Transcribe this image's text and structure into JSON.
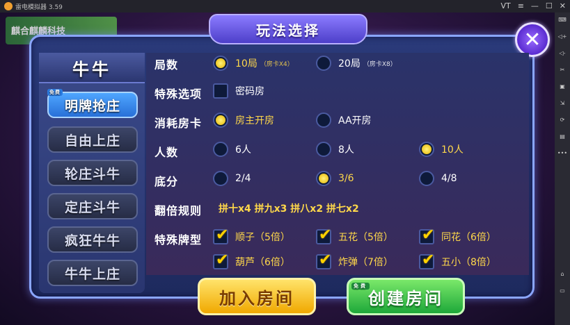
{
  "emulator": {
    "title": "雷电模拟器 3.59",
    "controls": [
      "VT",
      "≡",
      "—",
      "☐",
      "✕"
    ],
    "side_buttons": [
      "⌨",
      "◁+",
      "◁-",
      "✂",
      "▣",
      "⇲",
      "⟳",
      "▤",
      "•••",
      "⌂",
      "▭"
    ]
  },
  "background": {
    "banner_text": "麒合麒麟科技"
  },
  "dialog": {
    "title": "玩法选择",
    "close_label": "✕"
  },
  "left_panel": {
    "title": "牛牛",
    "modes": [
      {
        "label": "明牌抢庄",
        "active": true
      },
      {
        "label": "自由上庄",
        "active": false
      },
      {
        "label": "轮庄斗牛",
        "active": false
      },
      {
        "label": "定庄斗牛",
        "active": false
      },
      {
        "label": "疯狂牛牛",
        "active": false
      },
      {
        "label": "牛牛上庄",
        "active": false
      }
    ]
  },
  "options": {
    "rounds": {
      "label": "局数",
      "choices": [
        {
          "label": "10局",
          "note": "（房卡X4）",
          "selected": true
        },
        {
          "label": "20局",
          "note": "（房卡X8）",
          "selected": false
        }
      ]
    },
    "special": {
      "label": "特殊选项",
      "choices": [
        {
          "label": "密码房",
          "checked": false
        }
      ]
    },
    "cost": {
      "label": "消耗房卡",
      "choices": [
        {
          "label": "房主开房",
          "selected": true
        },
        {
          "label": "AA开房",
          "selected": false
        }
      ]
    },
    "players": {
      "label": "人数",
      "choices": [
        {
          "label": "6人",
          "selected": false
        },
        {
          "label": "8人",
          "selected": false
        },
        {
          "label": "10人",
          "selected": true
        }
      ]
    },
    "base": {
      "label": "底分",
      "choices": [
        {
          "label": "2/4",
          "selected": false
        },
        {
          "label": "3/6",
          "selected": true
        },
        {
          "label": "4/8",
          "selected": false
        }
      ]
    },
    "multiplier": {
      "label": "翻倍规则",
      "text": "拼十x4 拼九x3 拼八x2 拼七x2"
    },
    "special_hands": {
      "label": "特殊牌型",
      "choices": [
        {
          "label": "顺子（5倍）",
          "checked": true
        },
        {
          "label": "五花（5倍）",
          "checked": true
        },
        {
          "label": "同花（6倍）",
          "checked": true
        },
        {
          "label": "葫芦（6倍）",
          "checked": true
        },
        {
          "label": "炸弹（7倍）",
          "checked": true
        },
        {
          "label": "五小（8倍）",
          "checked": true
        }
      ]
    }
  },
  "buttons": {
    "join": "加入房间",
    "create": "创建房间",
    "free_tag": "免费"
  },
  "colors": {
    "selected_text": "#ffd84a",
    "active_tab": "#4fa6ff",
    "join": "#f0a800",
    "create": "#1ea83a"
  }
}
